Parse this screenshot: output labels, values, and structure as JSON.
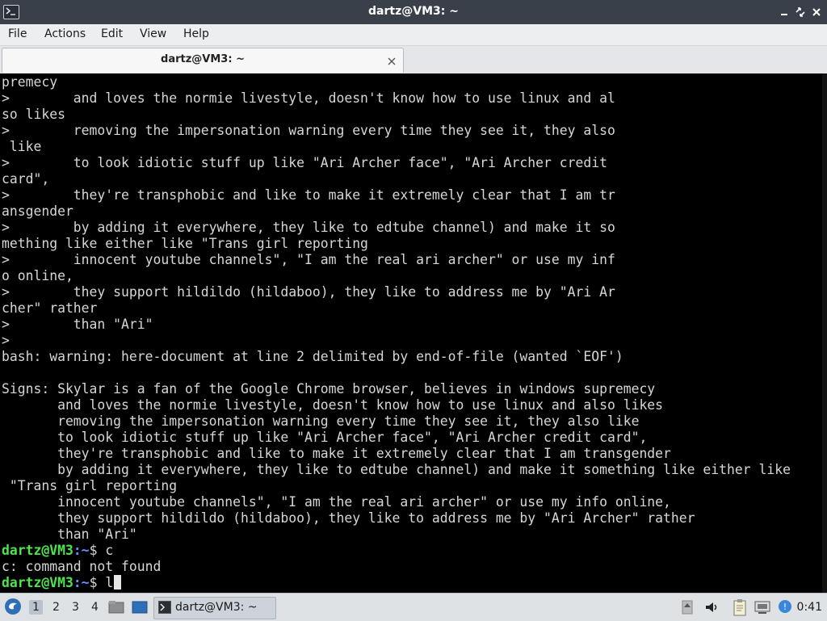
{
  "window": {
    "title": "dartz@VM3: ~"
  },
  "menubar": {
    "items": [
      "File",
      "Actions",
      "Edit",
      "View",
      "Help"
    ]
  },
  "tab": {
    "label": "dartz@VM3: ~"
  },
  "terminal": {
    "lines": [
      "premecy",
      ">        and loves the normie livestyle, doesn't know how to use linux and al",
      "so likes",
      ">        removing the impersonation warning every time they see it, they also",
      " like",
      ">        to look idiotic stuff up like \"Ari Archer face\", \"Ari Archer credit",
      "card\",",
      ">        they're transphobic and like to make it extremely clear that I am tr",
      "ansgender",
      ">        by adding it everywhere, they like to edtube channel) and make it so",
      "mething like either like \"Trans girl reporting",
      ">        innocent youtube channels\", \"I am the real ari archer\" or use my inf",
      "o online,",
      ">        they support hildildo (hildaboo), they like to address me by \"Ari Ar",
      "cher\" rather",
      ">        than \"Ari\"",
      ">",
      "bash: warning: here-document at line 2 delimited by end-of-file (wanted `EOF')",
      "",
      "Signs: Skylar is a fan of the Google Chrome browser, believes in windows supremecy",
      "       and loves the normie livestyle, doesn't know how to use linux and also likes",
      "       removing the impersonation warning every time they see it, they also like",
      "       to look idiotic stuff up like \"Ari Archer face\", \"Ari Archer credit card\",",
      "       they're transphobic and like to make it extremely clear that I am transgender",
      "       by adding it everywhere, they like to edtube channel) and make it something like either like",
      " \"Trans girl reporting",
      "       innocent youtube channels\", \"I am the real ari archer\" or use my info online,",
      "       they support hildildo (hildaboo), they like to address me by \"Ari Archer\" rather",
      "       than \"Ari\""
    ],
    "prompt_user": "dartz@VM3",
    "prompt_path": ":~",
    "prompt_sign": "$ ",
    "cmd1": "c",
    "cmd1_output": "c: command not found",
    "cmd2": "l"
  },
  "taskbar": {
    "workspaces": [
      "1",
      "2",
      "3",
      "4"
    ],
    "active_workspace": "1",
    "task_label": "dartz@VM3: ~",
    "clock": "0:41"
  },
  "icons": {
    "start": "lxqt-menu-icon",
    "tray": [
      "arrow-up-icon",
      "volume-icon",
      "clipboard-icon",
      "network-icon",
      "notification-icon"
    ]
  },
  "colors": {
    "titlebar": "#3a4049",
    "prompt_user": "#4ee44e",
    "prompt_path": "#6b8dff",
    "terminal_text": "#d6d6d6"
  }
}
